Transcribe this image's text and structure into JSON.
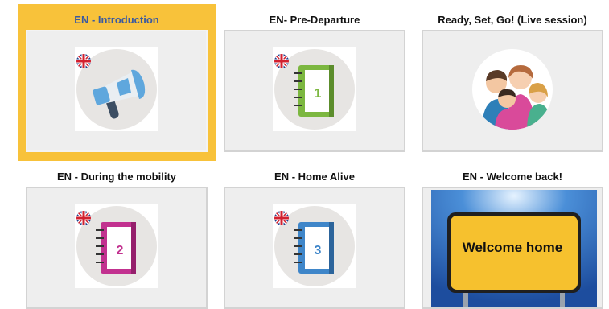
{
  "tiles": [
    {
      "title": "EN - Introduction",
      "icon": "megaphone-icon",
      "flag": "uk-flag-icon",
      "selected": true,
      "highlight_color": "#f8c23a",
      "title_color": "#3b5aa0"
    },
    {
      "title": "EN- Pre-Departure",
      "icon": "notebook-1-icon",
      "flag": "uk-flag-icon",
      "notebook_number": "1",
      "notebook_color": "#7cb740"
    },
    {
      "title": "Ready, Set, Go! (Live session)",
      "icon": "group-of-people-icon"
    },
    {
      "title": "EN - During the mobility",
      "icon": "notebook-2-icon",
      "flag": "uk-flag-icon",
      "notebook_number": "2",
      "notebook_color": "#c2318f"
    },
    {
      "title": "EN - Home Alive",
      "icon": "notebook-3-icon",
      "flag": "uk-flag-icon",
      "notebook_number": "3",
      "notebook_color": "#3f86c9"
    },
    {
      "title": "EN - Welcome back!",
      "icon": "welcome-home-sign",
      "sign_text": "Welcome home"
    }
  ]
}
